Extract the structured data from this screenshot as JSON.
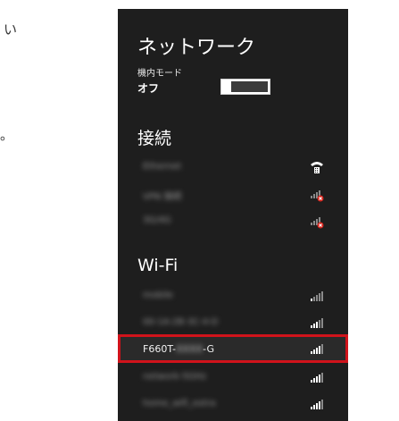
{
  "background": {
    "fragment1": "い",
    "fragment2": "。"
  },
  "panel": {
    "title": "ネットワーク",
    "airplane_mode_label": "機内モード",
    "airplane_mode_state": "オフ"
  },
  "connections": {
    "title": "接続",
    "items": [
      {
        "label": "Ethernet",
        "icon": "dialup-icon"
      },
      {
        "label": "VPN 接続",
        "icon": "signal-disconnected-icon"
      },
      {
        "label": "3G/4G",
        "icon": "signal-disconnected-icon"
      }
    ]
  },
  "wifi": {
    "title": "Wi-Fi",
    "items": [
      {
        "label": "mobile",
        "icon": "wifi-signal-icon"
      },
      {
        "label": "00-1A-2B-3C-4-D",
        "icon": "wifi-signal-icon"
      },
      {
        "label_prefix": "F660T-",
        "label_hidden": "XXXX",
        "label_suffix": "-G",
        "icon": "wifi-signal-icon",
        "selected": true
      },
      {
        "label": "network-5GHz",
        "icon": "wifi-signal-icon"
      },
      {
        "label": "home_wifi_extra",
        "icon": "wifi-signal-icon"
      }
    ]
  },
  "colors": {
    "panel_bg": "#1e1e1e",
    "highlight_border": "#d0131b"
  }
}
